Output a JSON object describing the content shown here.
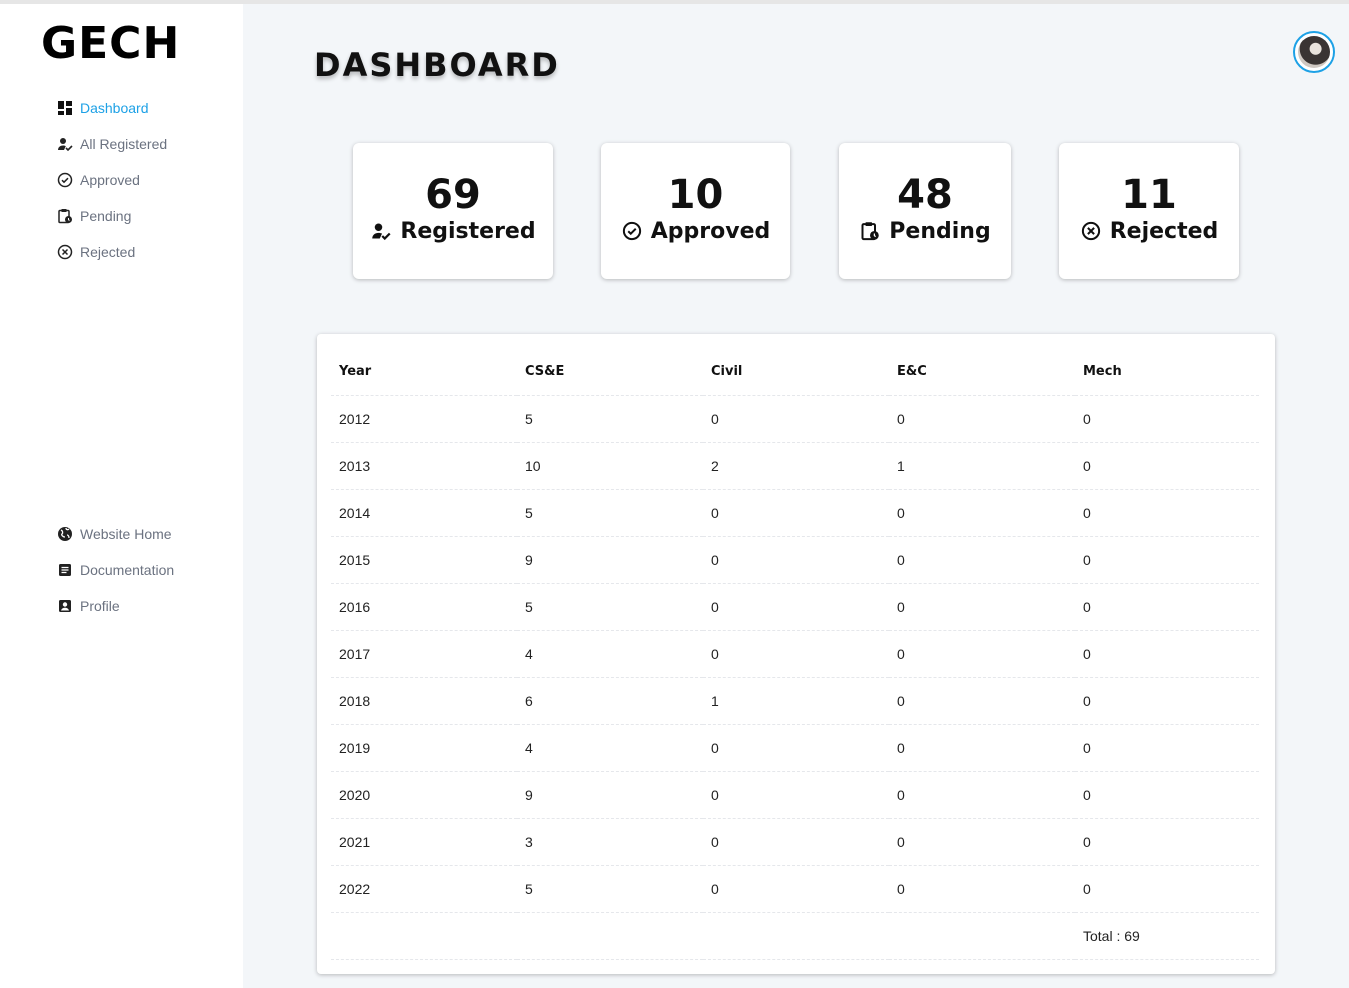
{
  "app": {
    "logo": "GECH"
  },
  "sidebar": {
    "items": [
      {
        "label": "Dashboard",
        "icon": "dashboard-icon",
        "active": true
      },
      {
        "label": "All Registered",
        "icon": "person-check-icon"
      },
      {
        "label": "Approved",
        "icon": "check-circle-icon"
      },
      {
        "label": "Pending",
        "icon": "clipboard-clock-icon"
      },
      {
        "label": "Rejected",
        "icon": "x-circle-icon"
      }
    ],
    "bottom_items": [
      {
        "label": "Website Home",
        "icon": "globe-icon"
      },
      {
        "label": "Documentation",
        "icon": "document-icon"
      },
      {
        "label": "Profile",
        "icon": "profile-icon"
      }
    ]
  },
  "header": {
    "title": "DASHBOARD"
  },
  "stats": [
    {
      "value": "69",
      "label": "Registered",
      "icon": "person-check-icon"
    },
    {
      "value": "10",
      "label": "Approved",
      "icon": "check-circle-icon"
    },
    {
      "value": "48",
      "label": "Pending",
      "icon": "clipboard-clock-icon"
    },
    {
      "value": "11",
      "label": "Rejected",
      "icon": "x-circle-icon"
    }
  ],
  "table": {
    "headers": [
      "Year",
      "CS&E",
      "Civil",
      "E&C",
      "Mech"
    ],
    "rows": [
      [
        "2012",
        "5",
        "0",
        "0",
        "0"
      ],
      [
        "2013",
        "10",
        "2",
        "1",
        "0"
      ],
      [
        "2014",
        "5",
        "0",
        "0",
        "0"
      ],
      [
        "2015",
        "9",
        "0",
        "0",
        "0"
      ],
      [
        "2016",
        "5",
        "0",
        "0",
        "0"
      ],
      [
        "2017",
        "4",
        "0",
        "0",
        "0"
      ],
      [
        "2018",
        "6",
        "1",
        "0",
        "0"
      ],
      [
        "2019",
        "4",
        "0",
        "0",
        "0"
      ],
      [
        "2020",
        "9",
        "0",
        "0",
        "0"
      ],
      [
        "2021",
        "3",
        "0",
        "0",
        "0"
      ],
      [
        "2022",
        "5",
        "0",
        "0",
        "0"
      ]
    ],
    "total": "Total : 69"
  },
  "colors": {
    "accent": "#1da1e6",
    "background": "#f3f6f9",
    "muted_text": "#6b7280"
  }
}
